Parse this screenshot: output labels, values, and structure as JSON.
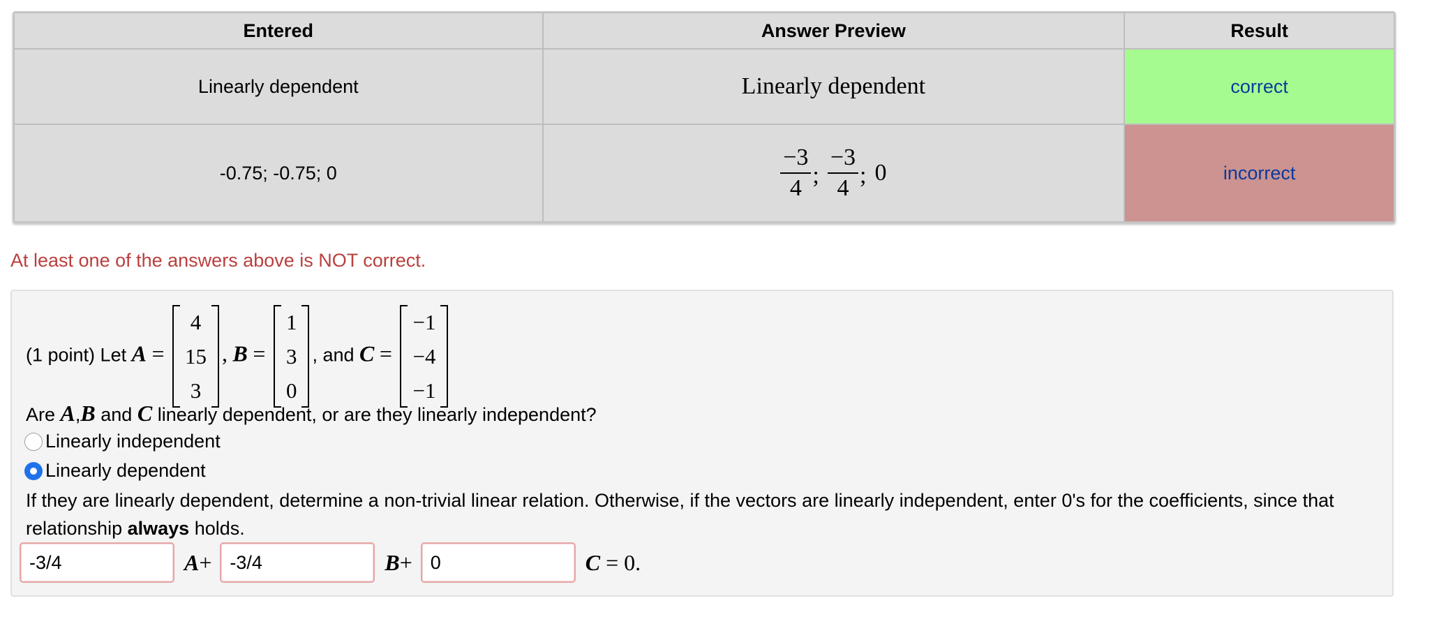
{
  "results_table": {
    "headers": [
      "Entered",
      "Answer Preview",
      "Result"
    ],
    "rows": [
      {
        "entered": "Linearly dependent",
        "preview": "Linearly dependent",
        "result": "correct",
        "result_color": "#a6fb90"
      },
      {
        "entered": "-0.75; -0.75; 0",
        "preview": {
          "frac1_num": "−3",
          "frac1_den": "4",
          "sep1": ";",
          "frac2_num": "−3",
          "frac2_den": "4",
          "sep2": ";",
          "last": "0"
        },
        "result": "incorrect",
        "result_color": "#cc9391"
      }
    ]
  },
  "message": "At least one of the answers above is NOT correct.",
  "problem": {
    "intro": "(1 point) Let",
    "var_a": "A",
    "var_b": "B",
    "var_c": "C",
    "equals": "=",
    "comma": ",",
    "and_text": ", and",
    "matrix_a": [
      "4",
      "15",
      "3"
    ],
    "matrix_b": [
      "1",
      "3",
      "0"
    ],
    "matrix_c": [
      "−1",
      "−4",
      "−1"
    ],
    "question_start": "Are",
    "question_comma": ",",
    "question_and": "and",
    "question_end": "linearly dependent, or are they linearly independent?",
    "options": [
      {
        "label": "Linearly independent",
        "checked": false
      },
      {
        "label": "Linearly dependent",
        "checked": true
      }
    ],
    "instruction_before_bold": "If they are linearly dependent, determine a non-trivial linear relation. Otherwise, if the vectors are linearly independent, enter 0's for the coefficients, since that relationship",
    "instruction_bold": "always",
    "instruction_after_bold": "holds.",
    "inputs": [
      {
        "value": "-3/4",
        "suffix_var": "A",
        "suffix_op": "+"
      },
      {
        "value": "-3/4",
        "suffix_var": "B",
        "suffix_op": "+"
      },
      {
        "value": "0",
        "suffix_var": "C",
        "suffix_op": "= 0."
      }
    ]
  }
}
